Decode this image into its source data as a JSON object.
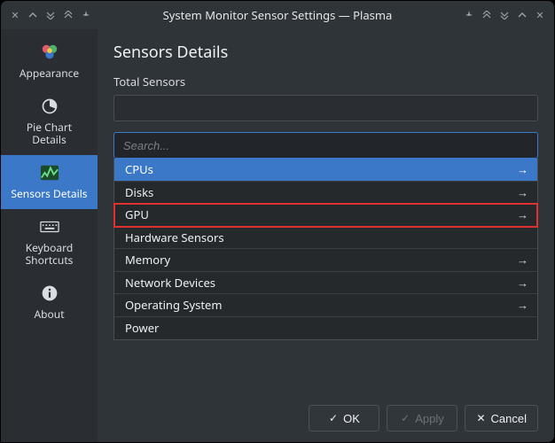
{
  "window": {
    "title": "System Monitor Sensor Settings — Plasma"
  },
  "sidebar": {
    "items": [
      {
        "id": "appearance",
        "label": "Appearance"
      },
      {
        "id": "pie-chart-details",
        "label": "Pie Chart\nDetails"
      },
      {
        "id": "sensors-details",
        "label": "Sensors Details"
      },
      {
        "id": "keyboard-shortcuts",
        "label": "Keyboard\nShortcuts"
      },
      {
        "id": "about",
        "label": "About"
      }
    ],
    "selected": "sensors-details"
  },
  "content": {
    "page_title": "Sensors Details",
    "section_label": "Total Sensors",
    "search_placeholder": "Search...",
    "rows": [
      {
        "label": "CPUs",
        "expandable": true,
        "selected": true,
        "highlight": false
      },
      {
        "label": "Disks",
        "expandable": true,
        "selected": false,
        "highlight": false
      },
      {
        "label": "GPU",
        "expandable": true,
        "selected": false,
        "highlight": true
      },
      {
        "label": "Hardware Sensors",
        "expandable": false,
        "selected": false,
        "highlight": false
      },
      {
        "label": "Memory",
        "expandable": true,
        "selected": false,
        "highlight": false
      },
      {
        "label": "Network Devices",
        "expandable": true,
        "selected": false,
        "highlight": false
      },
      {
        "label": "Operating System",
        "expandable": true,
        "selected": false,
        "highlight": false
      },
      {
        "label": "Power",
        "expandable": false,
        "selected": false,
        "highlight": false
      }
    ]
  },
  "buttons": {
    "ok": "OK",
    "apply": "Apply",
    "cancel": "Cancel"
  }
}
